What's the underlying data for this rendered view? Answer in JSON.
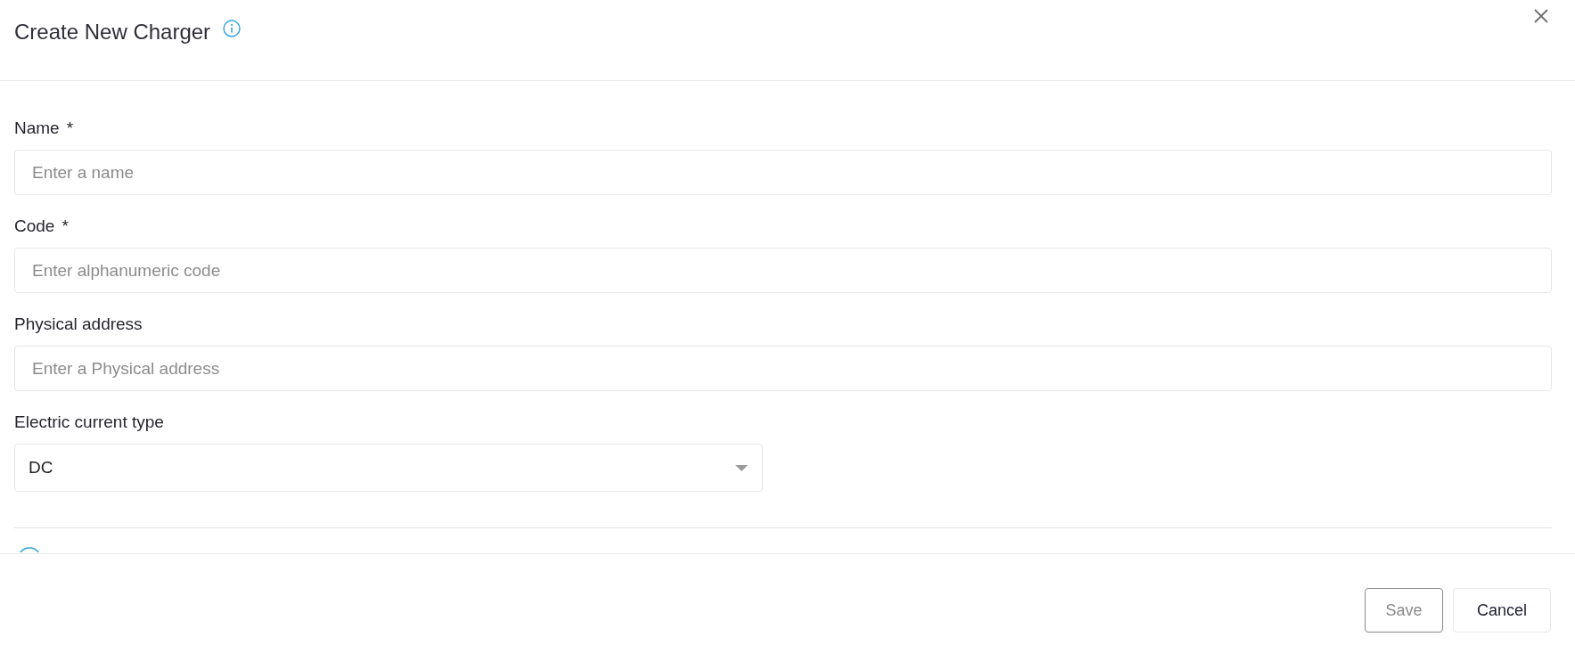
{
  "dialog": {
    "title": "Create New Charger"
  },
  "fields": [
    {
      "kind": "text",
      "label": "Name",
      "required_mark": "*",
      "placeholder": "Enter a name"
    },
    {
      "kind": "text",
      "label": "Code",
      "required_mark": "*",
      "placeholder": "Enter alphanumeric code"
    },
    {
      "kind": "text",
      "label": "Physical address",
      "placeholder": "Enter a Physical address"
    },
    {
      "kind": "select",
      "label": "Electric current type",
      "value": "DC"
    }
  ],
  "buttons": [
    {
      "label": "Save",
      "disabled": true
    },
    {
      "label": "Cancel",
      "disabled": false
    }
  ]
}
